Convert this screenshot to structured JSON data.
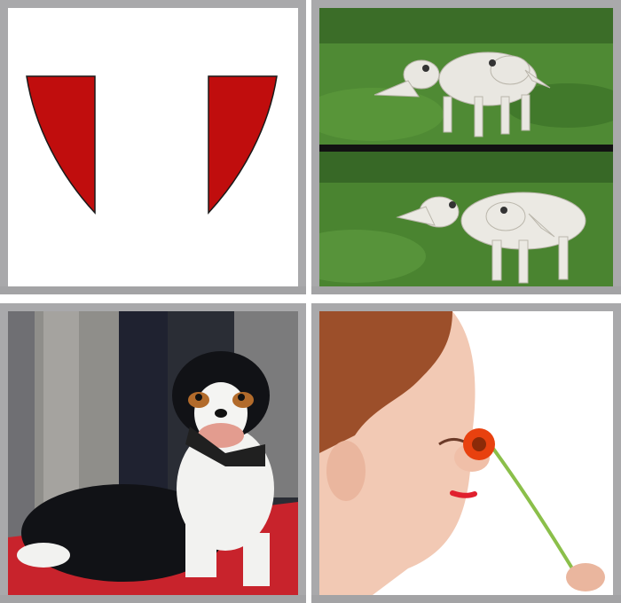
{
  "puzzle": {
    "tiles": [
      {
        "index": 1,
        "picture": "red-shield-halves"
      },
      {
        "index": 2,
        "picture": "two-headed-white-wolves"
      },
      {
        "index": 3,
        "picture": "dog-on-red-carpet"
      },
      {
        "index": 4,
        "picture": "woman-smelling-orange-gerbera"
      }
    ],
    "colors": {
      "frame": "#a9a9ab",
      "shield_red": "#c00d0d",
      "grass": "#3f7a2a",
      "carpet": "#c8232c",
      "flower": "#e8410f"
    }
  }
}
